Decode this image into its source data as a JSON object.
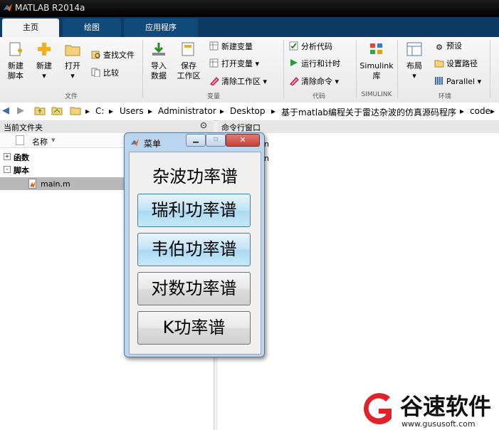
{
  "window": {
    "title": "MATLAB R2014a"
  },
  "tabs": [
    {
      "label": "主页"
    },
    {
      "label": "绘图"
    },
    {
      "label": "应用程序"
    }
  ],
  "ribbon": {
    "file": {
      "new_script": [
        "新建",
        "脚本"
      ],
      "new": "新建",
      "open": "打开",
      "find_files": "查找文件",
      "compare": "比较",
      "group": "文件"
    },
    "variable": {
      "import": [
        "导入",
        "数据"
      ],
      "save": [
        "保存",
        "工作区"
      ],
      "new_var": "新建变量",
      "open_var": "打开变量",
      "clear_ws": "清除工作区",
      "group": "变量"
    },
    "code": {
      "analyze": "分析代码",
      "run_time": "运行和计时",
      "clear_cmd": "清除命令",
      "group": "代码"
    },
    "simulink": {
      "lib": [
        "Simulink",
        "库"
      ],
      "group": "SIMULINK"
    },
    "env": {
      "layout": "布局",
      "prefs": "预设",
      "path": "设置路径",
      "parallel": "Parallel",
      "group": "环境"
    }
  },
  "address": {
    "segments": [
      "C:",
      "Users",
      "Administrator",
      "Desktop",
      "基于matlab编程关于雷达杂波的仿真源码程序",
      "code"
    ]
  },
  "left_panel": {
    "title": "当前文件夹",
    "col_name": "名称",
    "tree": [
      {
        "label": "函数",
        "expander": "+"
      },
      {
        "label": "脚本",
        "expander": "-"
      }
    ],
    "file": "main.m"
  },
  "right_panel": {
    "title": "命令行窗口",
    "lines": [
      "in",
      "in"
    ]
  },
  "dialog": {
    "title": "菜单",
    "heading": "杂波功率谱",
    "buttons": [
      "瑞利功率谱",
      "韦伯功率谱",
      "对数功率谱",
      "K功率谱"
    ]
  },
  "watermark": {
    "name": "谷速软件",
    "url": "www.gususoft.com",
    "color": "#e0232a"
  },
  "colors": {
    "tabbar": "#0d3b66",
    "title": "#000000",
    "dialog_frame": "#bcd5ee",
    "close_button": "#c9413a"
  }
}
